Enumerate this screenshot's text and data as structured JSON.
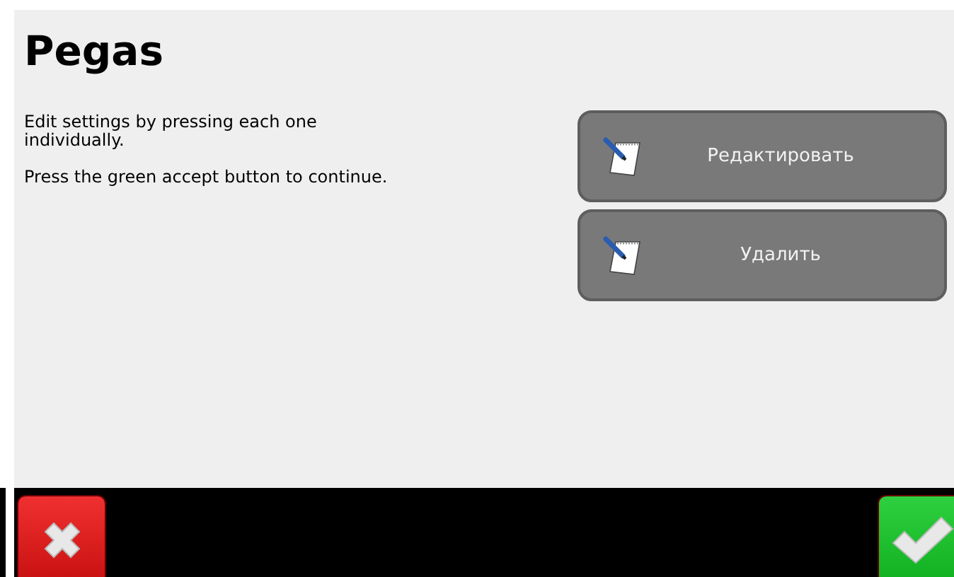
{
  "title": "Pegas",
  "instructions": [
    "Edit settings by pressing each one individually.",
    "Press the green accept button to continue."
  ],
  "actions": [
    {
      "label": "Редактировать"
    },
    {
      "label": "Удалить"
    }
  ],
  "footer": {
    "buttons": [
      {
        "kind": "cancel"
      },
      {
        "kind": "accept"
      }
    ]
  }
}
